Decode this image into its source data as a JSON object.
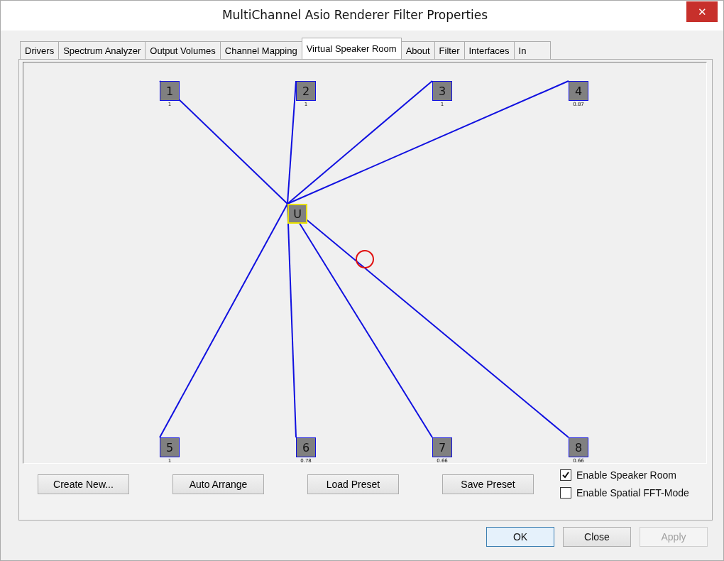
{
  "window": {
    "title": "MultiChannel Asio Renderer Filter Properties",
    "close": "✕"
  },
  "tabs": [
    {
      "label": "Drivers",
      "selected": false
    },
    {
      "label": "Spectrum Analyzer",
      "selected": false
    },
    {
      "label": "Output Volumes",
      "selected": false
    },
    {
      "label": "Channel Mapping",
      "selected": false
    },
    {
      "label": "Virtual Speaker Room",
      "selected": true
    },
    {
      "label": "About",
      "selected": false
    },
    {
      "label": "Filter",
      "selected": false
    },
    {
      "label": "Interfaces",
      "selected": false
    },
    {
      "label": "In",
      "selected": false
    }
  ],
  "room": {
    "listener": "U",
    "speakers": [
      {
        "label": "1",
        "gain": "1"
      },
      {
        "label": "2",
        "gain": "1"
      },
      {
        "label": "3",
        "gain": "1"
      },
      {
        "label": "4",
        "gain": "0.87"
      },
      {
        "label": "5",
        "gain": "1"
      },
      {
        "label": "6",
        "gain": "0.78"
      },
      {
        "label": "7",
        "gain": "0.66"
      },
      {
        "label": "8",
        "gain": "0.66"
      }
    ]
  },
  "buttons": [
    "Create New...",
    "Auto Arrange",
    "Load Preset",
    "Save Preset"
  ],
  "options": [
    {
      "label": "Enable Speaker Room",
      "checked": true
    },
    {
      "label": "Enable Spatial FFT-Mode",
      "checked": false
    }
  ],
  "dialog_buttons": [
    {
      "label": "OK",
      "kind": "default",
      "disabled": false
    },
    {
      "label": "Close",
      "kind": "normal",
      "disabled": false
    },
    {
      "label": "Apply",
      "kind": "normal",
      "disabled": true
    }
  ]
}
